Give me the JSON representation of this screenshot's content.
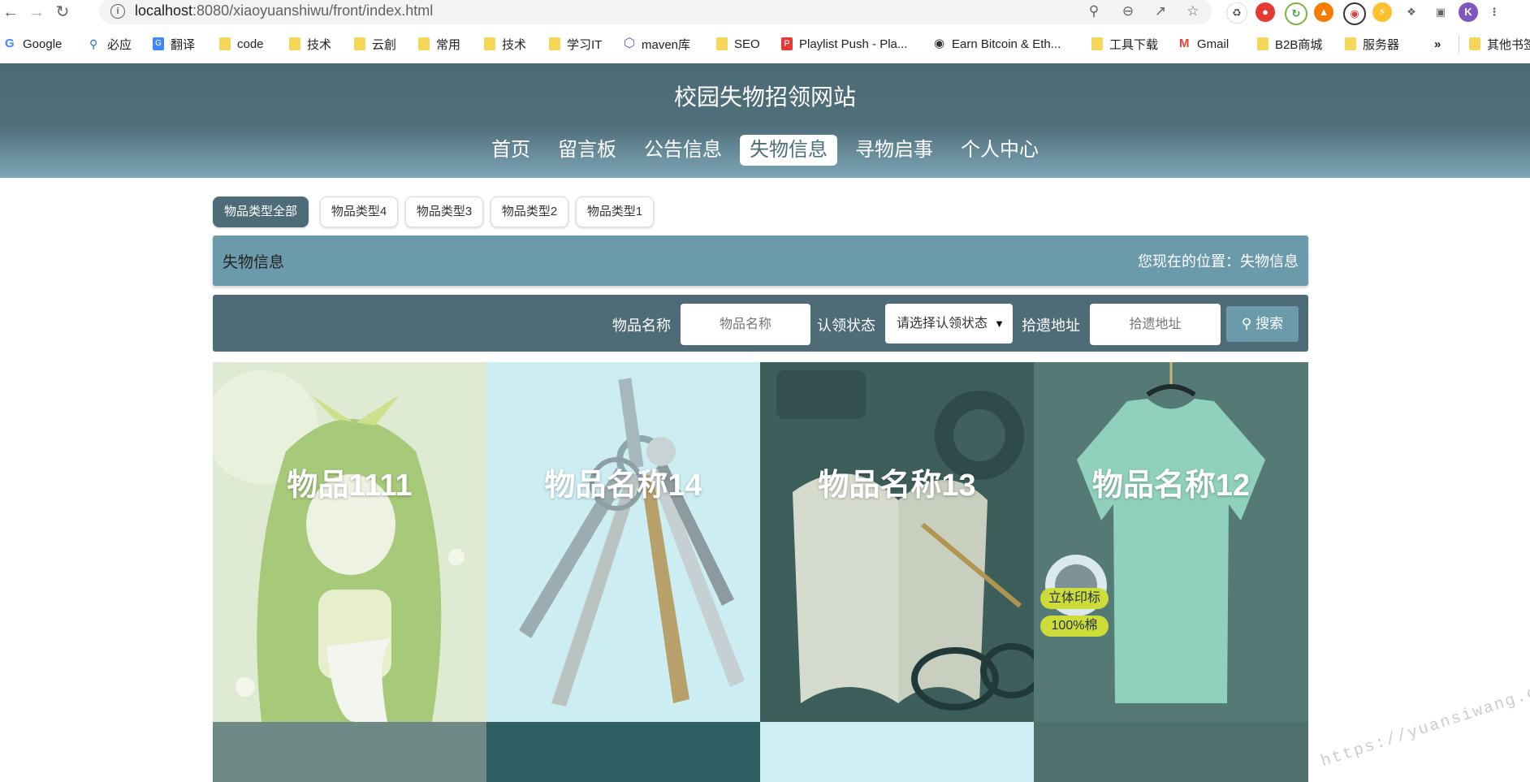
{
  "browser": {
    "url_host": "localhost",
    "url_rest": ":8080/xiaoyuanshiwu/front/index.html",
    "profile_initial": "K"
  },
  "bookmarks": [
    {
      "label": "Google",
      "icon": "google-icon"
    },
    {
      "label": "必应",
      "icon": "bing-search-icon"
    },
    {
      "label": "翻译",
      "icon": "translate-icon"
    },
    {
      "label": "code",
      "icon": "folder-icon"
    },
    {
      "label": "技术",
      "icon": "folder-icon"
    },
    {
      "label": "云創",
      "icon": "folder-icon"
    },
    {
      "label": "常用",
      "icon": "folder-icon"
    },
    {
      "label": "技术",
      "icon": "folder-icon"
    },
    {
      "label": "学习IT",
      "icon": "folder-icon"
    },
    {
      "label": "maven库",
      "icon": "hexagon-icon"
    },
    {
      "label": "SEO",
      "icon": "folder-icon"
    },
    {
      "label": "Playlist Push - Pla...",
      "icon": "playlist-icon"
    },
    {
      "label": "Earn Bitcoin & Eth...",
      "icon": "globe-icon"
    },
    {
      "label": "工具下载",
      "icon": "folder-icon"
    },
    {
      "label": "Gmail",
      "icon": "gmail-icon"
    },
    {
      "label": "B2B商城",
      "icon": "folder-icon"
    },
    {
      "label": "服务器",
      "icon": "folder-icon"
    },
    {
      "label": "»",
      "icon": ""
    },
    {
      "label": "其他书签",
      "icon": "folder-icon"
    }
  ],
  "site": {
    "title": "校园失物招领网站",
    "nav": [
      "首页",
      "留言板",
      "公告信息",
      "失物信息",
      "寻物启事",
      "个人中心"
    ],
    "active_nav": "失物信息"
  },
  "categories": [
    "物品类型全部",
    "物品类型4",
    "物品类型3",
    "物品类型2",
    "物品类型1"
  ],
  "breadcrumb": {
    "title": "失物信息",
    "position": "您现在的位置：失物信息"
  },
  "search": {
    "name_label": "物品名称",
    "name_placeholder": "物品名称",
    "status_label": "认领状态",
    "status_value": "请选择认领状态",
    "address_label": "拾遗地址",
    "address_placeholder": "拾遗地址",
    "button": "搜索"
  },
  "items": [
    {
      "title": "物品1111",
      "image": "anime-girl-illustration"
    },
    {
      "title": "物品名称14",
      "image": "keys-photo"
    },
    {
      "title": "物品名称13",
      "image": "notebook-photo"
    },
    {
      "title": "物品名称12",
      "image": "tshirt-photo",
      "badges": [
        "立体印标",
        "100%棉"
      ]
    }
  ],
  "watermark": "https://yuansiwang.com",
  "colors": {
    "header_dark": "#4e6c77",
    "accent": "#6b9aab"
  }
}
